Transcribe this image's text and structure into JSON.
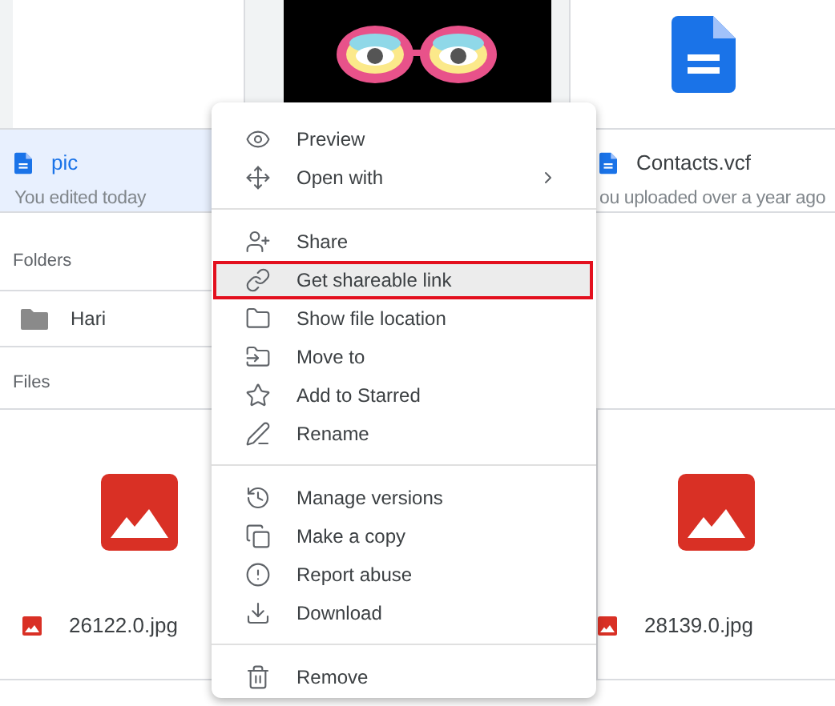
{
  "recent": [
    {
      "kind": "document",
      "name": "pic",
      "meta": "You edited today",
      "selected": true
    },
    {
      "kind": "video"
    },
    {
      "kind": "doc-icon",
      "name": "Contacts.vcf",
      "meta": "ou uploaded over a year ago",
      "selected": false
    }
  ],
  "folders_label": "Folders",
  "folders": [
    {
      "name": "Hari"
    }
  ],
  "files_label": "Files",
  "files": [
    {
      "name": "26122.0.jpg"
    },
    {
      "name": "28139.0.jpg"
    }
  ],
  "menu": {
    "groups": [
      [
        {
          "label": "Preview",
          "submenu": false,
          "highlighted": false
        },
        {
          "label": "Open with",
          "submenu": true,
          "highlighted": false
        }
      ],
      [
        {
          "label": "Share",
          "submenu": false,
          "highlighted": false
        },
        {
          "label": "Get shareable link",
          "submenu": false,
          "highlighted": true
        },
        {
          "label": "Show file location",
          "submenu": false,
          "highlighted": false
        },
        {
          "label": "Move to",
          "submenu": false,
          "highlighted": false
        },
        {
          "label": "Add to Starred",
          "submenu": false,
          "highlighted": false
        },
        {
          "label": "Rename",
          "submenu": false,
          "highlighted": false
        }
      ],
      [
        {
          "label": "Manage versions",
          "submenu": false,
          "highlighted": false
        },
        {
          "label": "Make a copy",
          "submenu": false,
          "highlighted": false
        },
        {
          "label": "Report abuse",
          "submenu": false,
          "highlighted": false
        },
        {
          "label": "Download",
          "submenu": false,
          "highlighted": false
        }
      ],
      [
        {
          "label": "Remove",
          "submenu": false,
          "highlighted": false
        }
      ]
    ]
  }
}
